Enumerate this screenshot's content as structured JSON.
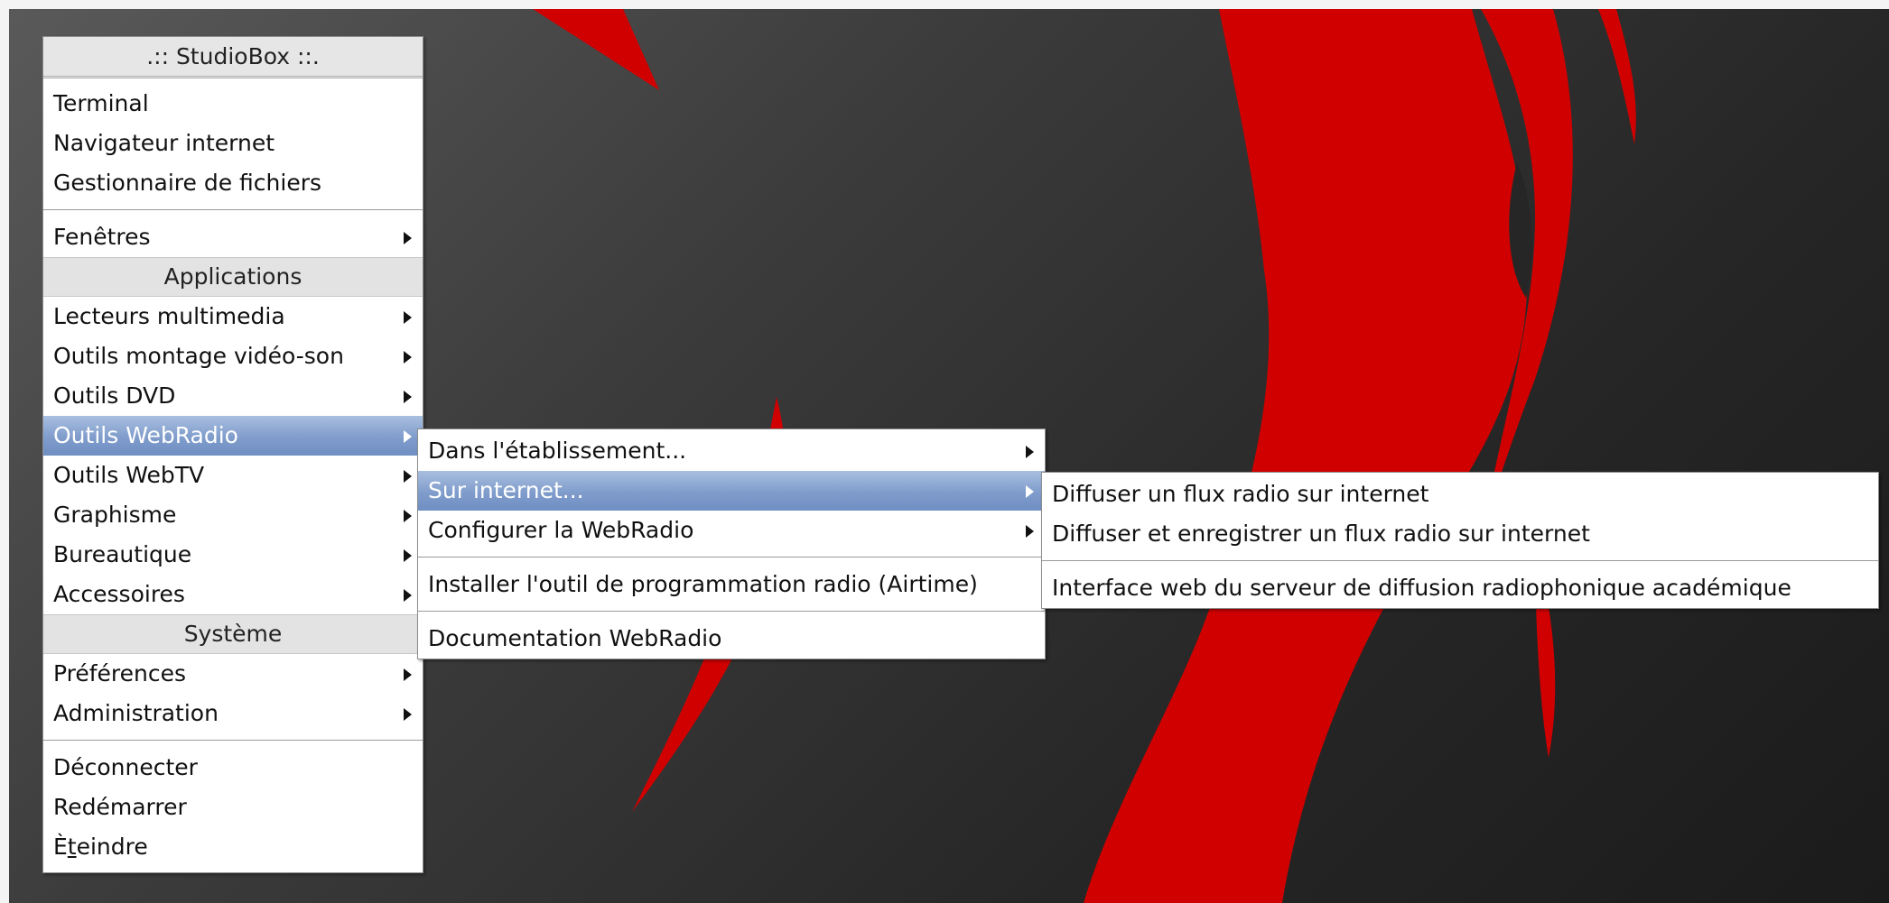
{
  "main_menu": {
    "title": ".:: StudioBox ::.",
    "group1": [
      "Terminal",
      "Navigateur internet",
      "Gestionnaire de fichiers"
    ],
    "windows_item": "Fenêtres",
    "applications_header": "Applications",
    "applications": [
      "Lecteurs multimedia",
      "Outils montage vidéo-son",
      "Outils DVD",
      "Outils WebRadio",
      "Outils WebTV",
      "Graphisme",
      "Bureautique",
      "Accessoires"
    ],
    "system_header": "Système",
    "system": [
      "Préférences",
      "Administration"
    ],
    "session": [
      "Déconnecter",
      "Redémarrer"
    ],
    "shutdown": {
      "first_letter": "È",
      "accel_letter": "t",
      "rest": "eindre"
    }
  },
  "webradio_menu": {
    "items": [
      "Dans l'établissement...",
      "Sur internet...",
      "Configurer la WebRadio",
      "Installer l'outil de programmation radio (Airtime)",
      "Documentation WebRadio"
    ]
  },
  "internet_menu": {
    "items": [
      "Diffuser un flux radio sur internet",
      "Diffuser et enregistrer un flux radio sur internet",
      "Interface web du serveur de diffusion radiophonique académique"
    ]
  },
  "colors": {
    "highlight": "#7f9ccb",
    "wallpaper_red": "#d10000",
    "wallpaper_dark": "#262626"
  }
}
